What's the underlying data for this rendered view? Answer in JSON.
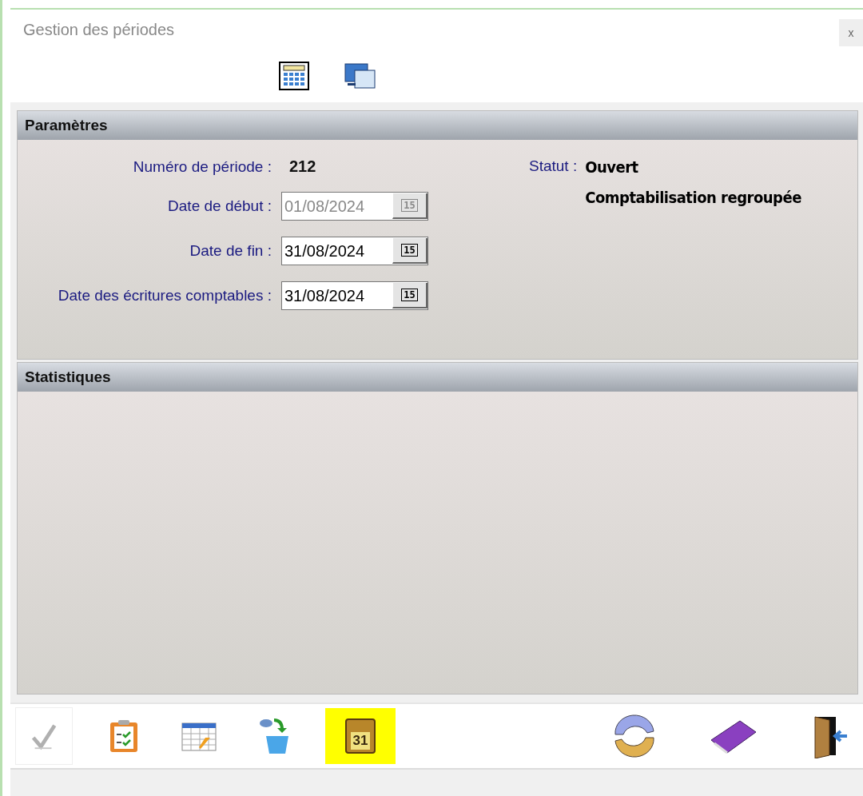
{
  "window": {
    "title": "Gestion des périodes",
    "close": "x"
  },
  "top_toolbar": [
    {
      "kind": "calculator"
    },
    {
      "kind": "screens"
    }
  ],
  "parameters": {
    "title": "Paramètres",
    "period": {
      "label": "Numéro de période :",
      "value": "212"
    },
    "status": {
      "label": "Statut :",
      "value": "Ouvert",
      "detail": "Comptabilisation regroupée"
    },
    "fields": [
      {
        "label": "Date de début :",
        "value": "01/08/2024",
        "picker": "15",
        "disabled": true
      },
      {
        "label": "Date de fin :",
        "value": "31/08/2024",
        "picker": "15",
        "disabled": false
      },
      {
        "label": "Date des écritures comptables :",
        "value": "31/08/2024",
        "picker": "15",
        "disabled": false
      }
    ]
  },
  "statistics": {
    "title": "Statistiques"
  },
  "bottom_toolbar": [
    {
      "kind": "check",
      "disabled": true,
      "highlighted": false
    },
    {
      "kind": "clipboard",
      "disabled": false,
      "highlighted": false
    },
    {
      "kind": "table",
      "disabled": false,
      "highlighted": false
    },
    {
      "kind": "bucket",
      "disabled": false,
      "highlighted": false
    },
    {
      "kind": "calendar",
      "label": "31",
      "disabled": false,
      "highlighted": true
    },
    {
      "kind": "refresh",
      "disabled": false,
      "highlighted": false
    },
    {
      "kind": "book",
      "disabled": false,
      "highlighted": false
    },
    {
      "kind": "exit",
      "disabled": false,
      "highlighted": false
    }
  ]
}
